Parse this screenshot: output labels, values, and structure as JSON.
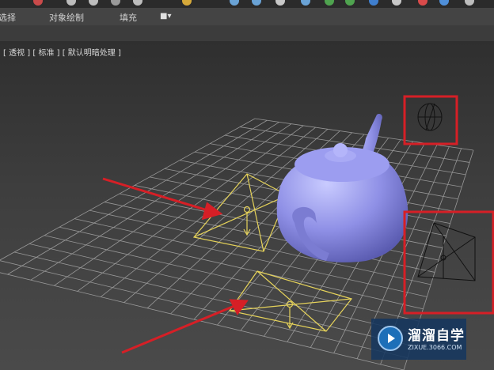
{
  "ribbon": {
    "tabs": [
      {
        "label": "选择"
      },
      {
        "label": "对象绘制"
      },
      {
        "label": "填充"
      }
    ],
    "dropdown_icon": "camera-dropdown-icon"
  },
  "viewport": {
    "label_parts": [
      "[ 透视 ]",
      "[ 标准 ]",
      "[ 默认明暗处理 ]"
    ]
  },
  "watermark": {
    "title": "溜溜自学",
    "url": "ZIXUE.3066.COM"
  },
  "colors": {
    "teapot": "#8f90e6",
    "selected_light": "#e6d35a",
    "grid": "#a7a7a7",
    "annotation_red": "#d61f26"
  }
}
